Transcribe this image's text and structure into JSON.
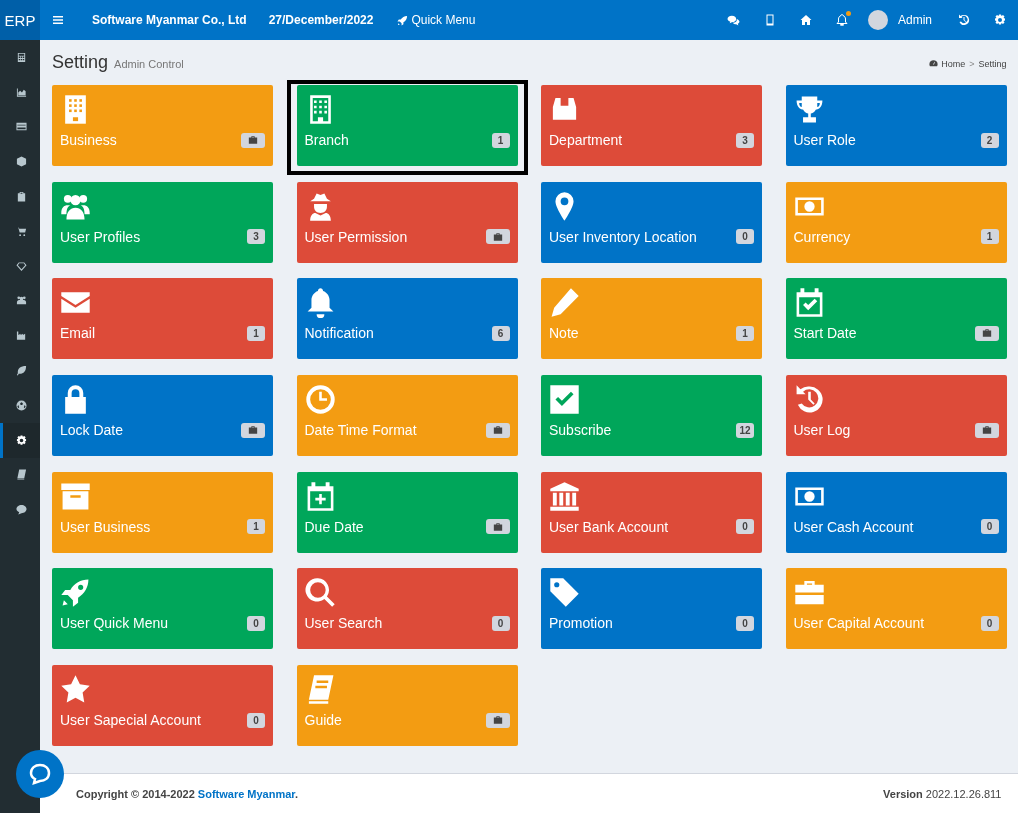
{
  "topbar": {
    "logo": "ERP",
    "company": "Software Myanmar Co., Ltd",
    "date": "27/December/2022",
    "quick_menu": "Quick Menu",
    "notification_alert": true,
    "user": "Admin"
  },
  "sidebar": {
    "items": [
      {
        "selected": false
      },
      {
        "selected": false
      },
      {
        "selected": false
      },
      {
        "selected": false
      },
      {
        "selected": false
      },
      {
        "selected": false
      },
      {
        "selected": false
      },
      {
        "selected": false
      },
      {
        "selected": false
      },
      {
        "selected": false
      },
      {
        "selected": false
      },
      {
        "selected": true
      },
      {
        "selected": false
      },
      {
        "selected": false
      }
    ]
  },
  "header": {
    "title": "Setting",
    "subtitle": "Admin Control",
    "breadcrumb": [
      "Home",
      "Setting"
    ],
    "separator": ">"
  },
  "tiles": [
    {
      "label": "Business",
      "color": "#f39c12",
      "kind": "icon",
      "selected": false
    },
    {
      "label": "Branch",
      "color": "#00a65a",
      "kind": "count",
      "count": "1",
      "selected": true
    },
    {
      "label": "Department",
      "color": "#dd4b39",
      "kind": "count",
      "count": "3",
      "selected": false
    },
    {
      "label": "User Role",
      "color": "#0073c7",
      "kind": "count",
      "count": "2",
      "selected": false
    },
    {
      "label": "User Profiles",
      "color": "#00a65a",
      "kind": "count",
      "count": "3",
      "selected": false
    },
    {
      "label": "User Permission",
      "color": "#dd4b39",
      "kind": "icon",
      "selected": false
    },
    {
      "label": "User Inventory Location",
      "color": "#0073c7",
      "kind": "count",
      "count": "0",
      "selected": false
    },
    {
      "label": "Currency",
      "color": "#f39c12",
      "kind": "count",
      "count": "1",
      "selected": false
    },
    {
      "label": "Email",
      "color": "#dd4b39",
      "kind": "count",
      "count": "1",
      "selected": false
    },
    {
      "label": "Notification",
      "color": "#0073c7",
      "kind": "count",
      "count": "6",
      "selected": false
    },
    {
      "label": "Note",
      "color": "#f39c12",
      "kind": "count",
      "count": "1",
      "selected": false
    },
    {
      "label": "Start Date",
      "color": "#00a65a",
      "kind": "icon",
      "selected": false
    },
    {
      "label": "Lock Date",
      "color": "#0073c7",
      "kind": "icon",
      "selected": false
    },
    {
      "label": "Date Time Format",
      "color": "#f39c12",
      "kind": "icon",
      "selected": false
    },
    {
      "label": "Subscribe",
      "color": "#00a65a",
      "kind": "count",
      "count": "12",
      "selected": false
    },
    {
      "label": "User Log",
      "color": "#dd4b39",
      "kind": "icon",
      "selected": false
    },
    {
      "label": "User Business",
      "color": "#f39c12",
      "kind": "count",
      "count": "1",
      "selected": false
    },
    {
      "label": "Due Date",
      "color": "#00a65a",
      "kind": "icon",
      "selected": false
    },
    {
      "label": "User Bank Account",
      "color": "#dd4b39",
      "kind": "count",
      "count": "0",
      "selected": false
    },
    {
      "label": "User Cash Account",
      "color": "#0073c7",
      "kind": "count",
      "count": "0",
      "selected": false
    },
    {
      "label": "User Quick Menu",
      "color": "#00a65a",
      "kind": "count",
      "count": "0",
      "selected": false
    },
    {
      "label": "User Search",
      "color": "#dd4b39",
      "kind": "count",
      "count": "0",
      "selected": false
    },
    {
      "label": "Promotion",
      "color": "#0073c7",
      "kind": "count",
      "count": "0",
      "selected": false
    },
    {
      "label": "User Capital Account",
      "color": "#f39c12",
      "kind": "count",
      "count": "0",
      "selected": false
    },
    {
      "label": "User Sapecial Account",
      "color": "#dd4b39",
      "kind": "count",
      "count": "0",
      "selected": false
    },
    {
      "label": "Guide",
      "color": "#f39c12",
      "kind": "icon",
      "selected": false
    }
  ],
  "footer": {
    "copyright": "Copyright © 2014-2022",
    "link": "Software Myanmar",
    "period": ".",
    "version_label": "Version",
    "version": "2022.12.26.811"
  }
}
